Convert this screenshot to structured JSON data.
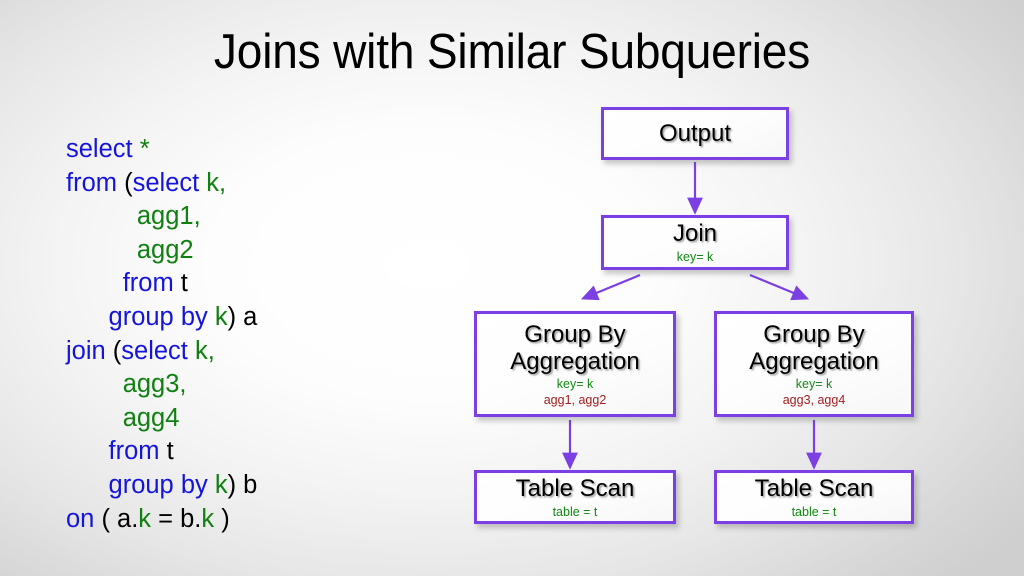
{
  "slide": {
    "title": "Joins with Similar Subqueries",
    "background_center_color": "#ffffff",
    "background_edge_color": "#d4d4d4"
  },
  "colors": {
    "keyword": "#1414dc",
    "identifier": "#108010",
    "punctuation": "#000000",
    "node_border": "#7b3fe4",
    "arrow": "#7b3fe4",
    "meta_key": "#118a11",
    "meta_agg": "#a32020"
  },
  "sql": {
    "lines": [
      {
        "indent": 0,
        "tokens": [
          {
            "text": "select ",
            "kind": "kw"
          },
          {
            "text": "*",
            "kind": "id"
          }
        ]
      },
      {
        "indent": 0,
        "tokens": [
          {
            "text": "from ",
            "kind": "kw"
          },
          {
            "text": "(",
            "kind": "pl"
          },
          {
            "text": "select ",
            "kind": "kw"
          },
          {
            "text": "k,",
            "kind": "id"
          }
        ]
      },
      {
        "indent": 5,
        "tokens": [
          {
            "text": "agg1,",
            "kind": "id"
          }
        ]
      },
      {
        "indent": 5,
        "tokens": [
          {
            "text": "agg2",
            "kind": "id"
          }
        ]
      },
      {
        "indent": 4,
        "tokens": [
          {
            "text": "from ",
            "kind": "kw"
          },
          {
            "text": "t",
            "kind": "pl"
          }
        ]
      },
      {
        "indent": 3,
        "tokens": [
          {
            "text": "group by ",
            "kind": "kw"
          },
          {
            "text": "k",
            "kind": "id"
          },
          {
            "text": ") a",
            "kind": "pl"
          }
        ]
      },
      {
        "indent": 0,
        "tokens": [
          {
            "text": "join ",
            "kind": "kw"
          },
          {
            "text": "(",
            "kind": "pl"
          },
          {
            "text": "select ",
            "kind": "kw"
          },
          {
            "text": "k,",
            "kind": "id"
          }
        ]
      },
      {
        "indent": 4,
        "tokens": [
          {
            "text": "agg3,",
            "kind": "id"
          }
        ]
      },
      {
        "indent": 4,
        "tokens": [
          {
            "text": "agg4",
            "kind": "id"
          }
        ]
      },
      {
        "indent": 3,
        "tokens": [
          {
            "text": "from ",
            "kind": "kw"
          },
          {
            "text": "t",
            "kind": "pl"
          }
        ]
      },
      {
        "indent": 3,
        "tokens": [
          {
            "text": "group by ",
            "kind": "kw"
          },
          {
            "text": "k",
            "kind": "id"
          },
          {
            "text": ") b",
            "kind": "pl"
          }
        ]
      },
      {
        "indent": 0,
        "tokens": [
          {
            "text": "on ",
            "kind": "kw"
          },
          {
            "text": "( a.",
            "kind": "pl"
          },
          {
            "text": "k",
            "kind": "id"
          },
          {
            "text": " = b.",
            "kind": "pl"
          },
          {
            "text": "k",
            "kind": "id"
          },
          {
            "text": " )",
            "kind": "pl"
          }
        ]
      }
    ]
  },
  "diagram": {
    "nodes": {
      "output": {
        "title": "Output"
      },
      "join": {
        "title": "Join",
        "key": "key= k"
      },
      "gb_left": {
        "title": "Group By\nAggregation",
        "key": "key= k",
        "agg": "agg1, agg2"
      },
      "gb_right": {
        "title": "Group By\nAggregation",
        "key": "key= k",
        "agg": "agg3, agg4"
      },
      "ts_left": {
        "title": "Table Scan",
        "table": "table = t"
      },
      "ts_right": {
        "title": "Table Scan",
        "table": "table = t"
      }
    },
    "edges": [
      {
        "from": "output",
        "to": "join",
        "kind": "vertical"
      },
      {
        "from": "join",
        "to": "gb_left",
        "kind": "diagonal-left"
      },
      {
        "from": "join",
        "to": "gb_right",
        "kind": "diagonal-right"
      },
      {
        "from": "gb_left",
        "to": "ts_left",
        "kind": "vertical"
      },
      {
        "from": "gb_right",
        "to": "ts_right",
        "kind": "vertical"
      }
    ]
  }
}
